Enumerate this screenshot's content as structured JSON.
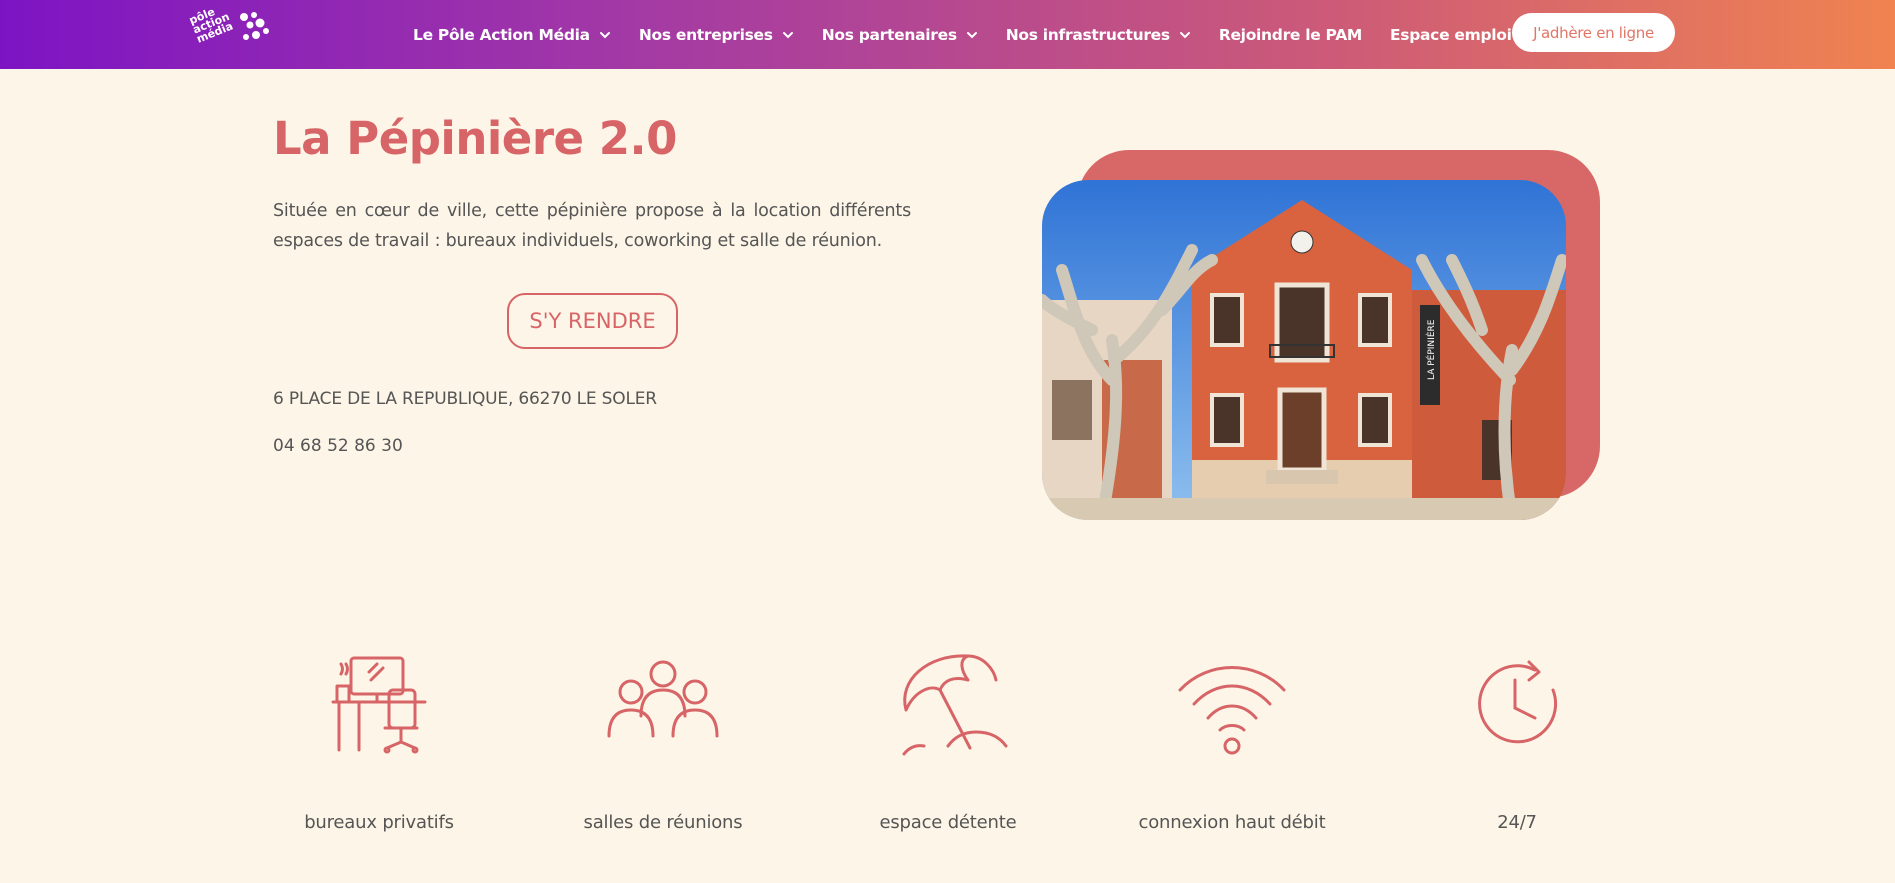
{
  "navbar": {
    "logo_lines": [
      "pôle",
      "action",
      "média"
    ],
    "items": [
      {
        "label": "Le Pôle Action Média",
        "has_dropdown": true
      },
      {
        "label": "Nos entreprises",
        "has_dropdown": true
      },
      {
        "label": "Nos partenaires",
        "has_dropdown": true
      },
      {
        "label": "Nos infrastructures",
        "has_dropdown": true
      },
      {
        "label": "Rejoindre le PAM",
        "has_dropdown": false
      },
      {
        "label": "Espace emploi",
        "has_dropdown": false
      }
    ],
    "cta_label": "J'adhère en ligne"
  },
  "hero": {
    "title": "La Pépinière 2.0",
    "description": "Située en cœur de ville, cette pépinière propose à la location différents espaces de travail : bureaux individuels, coworking et salle de réunion.",
    "button_label": "S'Y RENDRE",
    "address": "6 PLACE DE LA REPUBLIQUE, 66270 LE SOLER",
    "phone": "04 68 52 86 30",
    "building_sign": "LA PÉPINIÈRE"
  },
  "features": [
    {
      "icon": "desk-icon",
      "label": "bureaux privatifs"
    },
    {
      "icon": "group-icon",
      "label": "salles de réunions"
    },
    {
      "icon": "beach-umbrella-icon",
      "label": "espace détente"
    },
    {
      "icon": "wifi-icon",
      "label": "connexion haut débit"
    },
    {
      "icon": "clock-icon",
      "label": "24/7"
    }
  ],
  "colors": {
    "accent": "#d76466",
    "background": "#fdf6e8",
    "nav_gradient_start": "#7d14c4",
    "nav_gradient_end": "#f08350"
  }
}
